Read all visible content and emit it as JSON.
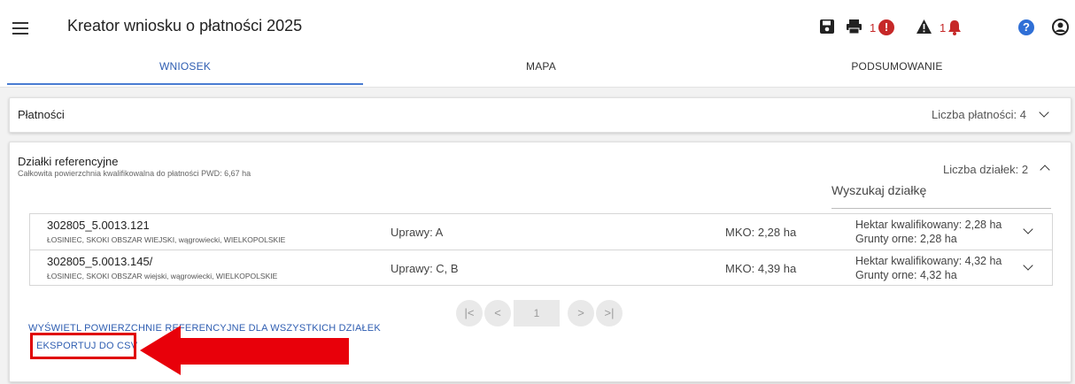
{
  "header": {
    "title": "Kreator wniosku o płatności 2025",
    "errors_count": "1",
    "warnings_count": "1",
    "icons": [
      "menu-icon",
      "save-icon",
      "print-icon",
      "error-icon",
      "warning-icon",
      "bell-icon",
      "help-icon",
      "user-icon"
    ]
  },
  "tabs": [
    {
      "label": "WNIOSEK",
      "active": true
    },
    {
      "label": "MAPA",
      "active": false
    },
    {
      "label": "PODSUMOWANIE",
      "active": false
    }
  ],
  "payments": {
    "title": "Płatności",
    "count_label": "Liczba płatności: 4"
  },
  "parcels": {
    "title": "Działki referencyjne",
    "subtitle": "Całkowita powierzchnia kwalifikowalna do płatności PWD: 6,67 ha",
    "count_label": "Liczba działek: 2",
    "search_label": "Wyszukaj działkę",
    "rows": [
      {
        "id": "302805_5.0013.121",
        "location": "ŁOSINIEC, SKOKI OBSZAR WIEJSKI, wągrowiecki, WIELKOPOLSKIE",
        "crops": "Uprawy: A",
        "mko": "MKO: 2,28 ha",
        "hectare": "Hektar kwalifikowany: 2,28 ha",
        "arable": "Grunty orne: 2,28 ha"
      },
      {
        "id": "302805_5.0013.145/",
        "location": "ŁOSINIEC, SKOKI OBSZAR wiejski, wągrowiecki, WIELKOPOLSKIE",
        "crops": "Uprawy: C, B",
        "mko": "MKO: 4,39 ha",
        "hectare": "Hektar kwalifikowany: 4,32 ha",
        "arable": "Grunty orne: 4,32 ha"
      }
    ],
    "pager": {
      "current_page": "1"
    },
    "show_ref_link": "WYŚWIETL POWIERZCHNIE REFERENCYJNE DLA WSZYSTKICH DZIAŁEK",
    "export_link": "EKSPORTUJ DO CSV"
  },
  "colors": {
    "accent": "#2e5db1",
    "error": "#c62828",
    "help": "#2f6fd6",
    "annotation": "#e00000"
  }
}
